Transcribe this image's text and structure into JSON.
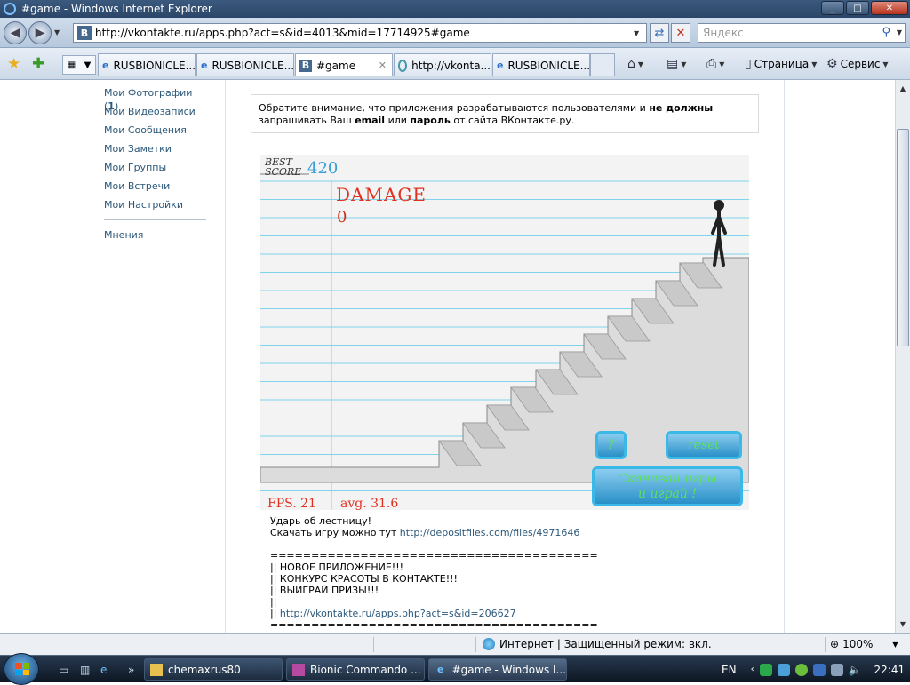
{
  "window": {
    "title": "#game - Windows Internet Explorer",
    "minimize": "_",
    "maximize": "□",
    "close": "✕"
  },
  "address": {
    "url": "http://vkontakte.ru/apps.php?act=s&id=4013&mid=17714925#game",
    "site_icon": "В",
    "search_placeholder": "Яндекс"
  },
  "tabs": [
    {
      "label": "RUSBIONICLE...",
      "icon": "ie-icon"
    },
    {
      "label": "RUSBIONICLE...",
      "icon": "ie-icon"
    },
    {
      "label": "#game",
      "icon": "vk-icon",
      "active": true
    },
    {
      "label": "http://vkonta...",
      "icon": "loading-icon"
    },
    {
      "label": "RUSBIONICLE...",
      "icon": "ie-icon"
    }
  ],
  "commands": {
    "page": "Страница",
    "tools": "Сервис"
  },
  "sidebar": {
    "items": [
      {
        "label": "Мои Фотографии",
        "count": "1"
      },
      {
        "label": "Мои Видеозаписи"
      },
      {
        "label": "Мои Сообщения"
      },
      {
        "label": "Мои Заметки"
      },
      {
        "label": "Мои Группы"
      },
      {
        "label": "Мои Встречи"
      },
      {
        "label": "Мои Настройки"
      }
    ],
    "opinions": "Мнения"
  },
  "notice": {
    "part1": "Обратите внимание, что приложения разрабатываются пользователями и ",
    "bold1": "не должны",
    "part2": " запрашивать Ваш ",
    "bold2": "email",
    "part3": " или ",
    "bold3": "пароль",
    "part4": " от сайта ВКонтакте.ру."
  },
  "game": {
    "best_label_1": "BEST",
    "best_label_2": "SCORE",
    "best_score": "420",
    "damage_label": "DAMAGE",
    "damage_value": "0",
    "fps": "FPS. 21",
    "avg": "avg. 31.6",
    "help_button": "?",
    "reset_button": "reset",
    "download_button_1": "Скачивай игры",
    "download_button_2": "и играй !",
    "colors": {
      "accent_red": "#e03020",
      "score_blue": "#3a9ed8",
      "line_blue": "#7fd3ea",
      "button_green": "#5de05a"
    }
  },
  "description": {
    "line1": "Ударь об лестницу!",
    "line2_text": "Скачать игру можно тут ",
    "line2_link": "http://depositfiles.com/files/4971646",
    "separator": "========================================",
    "promo1": "|| НОВОЕ ПРИЛОЖЕНИЕ!!!",
    "promo2": "|| КОНКУРС КРАСОТЫ В КОНТАКТЕ!!!",
    "promo3": "|| ВЫИГРАЙ ПРИЗЫ!!!",
    "promo4": "||",
    "promo5_prefix": "|| ",
    "promo5_link": "http://vkontakte.ru/apps.php?act=s&id=206627",
    "separator2": "========================================"
  },
  "status": {
    "zone": "Интернет | Защищенный режим: вкл.",
    "zoom": "100%"
  },
  "taskbar": {
    "tasks": [
      {
        "label": "chemaxrus80",
        "icon": "folder-icon"
      },
      {
        "label": "Bionic Commando ...",
        "icon": "winrar-icon"
      },
      {
        "label": "#game - Windows I...",
        "icon": "ie-icon",
        "active": true
      }
    ],
    "lang": "EN",
    "clock": "22:41",
    "more": "»"
  }
}
